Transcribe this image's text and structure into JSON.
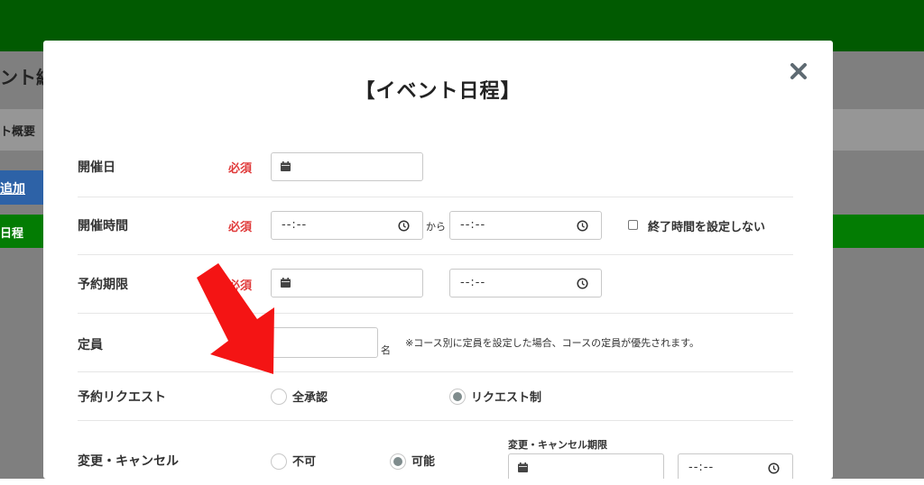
{
  "background": {
    "title_fragment": "ント編",
    "band_text": "ト概要",
    "button_text": "追加",
    "green_text": "日程",
    "colors": {
      "topbar": "#015a01",
      "green_row": "#037c03",
      "button": "#2d62a7"
    }
  },
  "modal": {
    "title": "【イベント日程】",
    "close_icon": "close-icon",
    "required_label": "必須",
    "rows": {
      "date": {
        "label": "開催日",
        "required": "必須",
        "value": ""
      },
      "time": {
        "label": "開催時間",
        "required": "必須",
        "start": "--:--",
        "separator": "から",
        "end": "--:--",
        "no_end_label": "終了時間を設定しない"
      },
      "deadline": {
        "label": "予約期限",
        "required": "必須",
        "date": "",
        "time": "--:--"
      },
      "capacity": {
        "label": "定員",
        "value": "",
        "unit": "名",
        "note": "※コース別に定員を設定した場合、コースの定員が優先されます。"
      },
      "request": {
        "label": "予約リクエスト",
        "options": [
          "全承認",
          "リクエスト制"
        ],
        "selected": "リクエスト制"
      },
      "change": {
        "label": "変更・キャンセル",
        "options": [
          "不可",
          "可能"
        ],
        "selected": "可能",
        "period_label": "変更・キャンセル期限",
        "time": "--:--"
      }
    }
  },
  "annotation": {
    "arrow_color": "#f41414"
  }
}
